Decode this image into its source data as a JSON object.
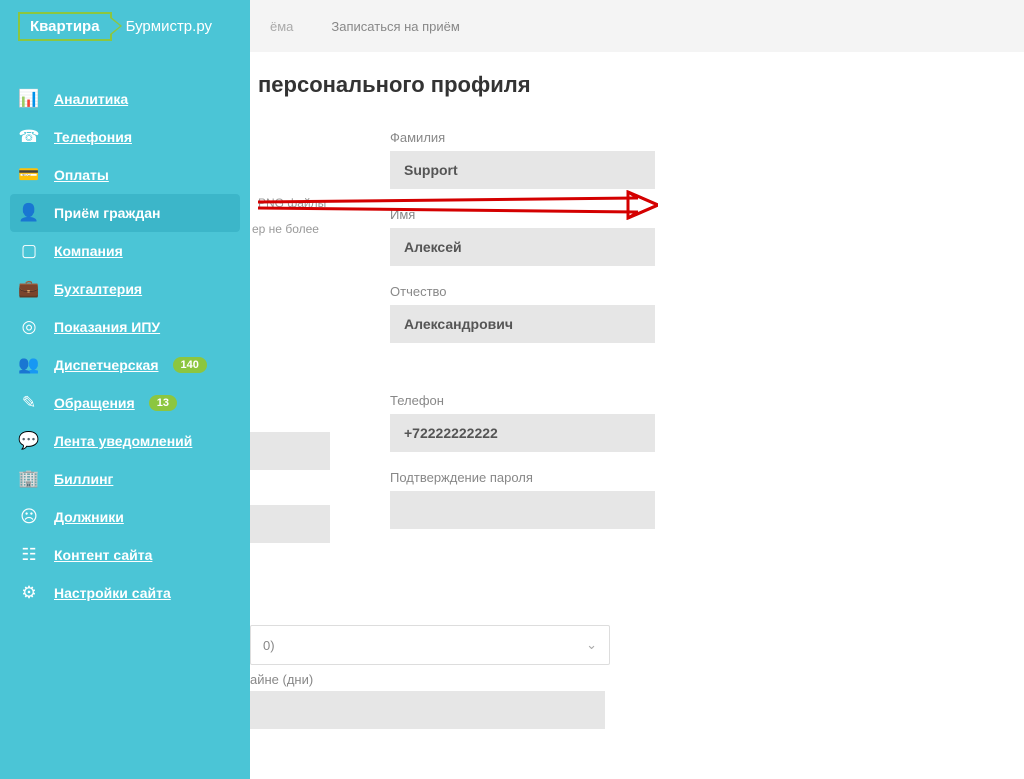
{
  "logo": {
    "box": "Квартира",
    "text": "Бурмистр.ру"
  },
  "tabs": {
    "partial": "ёма",
    "signup": "Записаться на приём"
  },
  "page": {
    "title_partial": "персонального профиля"
  },
  "sidebar": {
    "items": [
      {
        "label": "Аналитика",
        "icon": "📊"
      },
      {
        "label": "Телефония",
        "icon": "☎"
      },
      {
        "label": "Оплаты",
        "icon": "💳"
      },
      {
        "label": "Приём граждан",
        "icon": "👤"
      },
      {
        "label": "Компания",
        "icon": "▢"
      },
      {
        "label": "Бухгалтерия",
        "icon": "💼"
      },
      {
        "label": "Показания ИПУ",
        "icon": "◎"
      },
      {
        "label": "Диспетчерская",
        "icon": "👥",
        "badge": "140"
      },
      {
        "label": "Обращения",
        "icon": "✎",
        "badge": "13"
      },
      {
        "label": "Лента уведомлений",
        "icon": "💬"
      },
      {
        "label": "Биллинг",
        "icon": "🏢"
      },
      {
        "label": "Должники",
        "icon": "☹"
      },
      {
        "label": "Контент сайта",
        "icon": "☷"
      },
      {
        "label": "Настройки сайта",
        "icon": "⚙"
      }
    ]
  },
  "hints": {
    "png": "PNG файлы",
    "size": "ер не более"
  },
  "form": {
    "surname_label": "Фамилия",
    "surname_value": "Support",
    "name_label": "Имя",
    "name_value": "Алексей",
    "patronymic_label": "Отчество",
    "patronymic_value": "Александрович",
    "phone_label": "Телефон",
    "phone_value": "+72222222222",
    "pwconfirm_label": "Подтверждение пароля"
  },
  "bottom": {
    "select_partial": "0)",
    "days_label": "айне (дни)"
  }
}
